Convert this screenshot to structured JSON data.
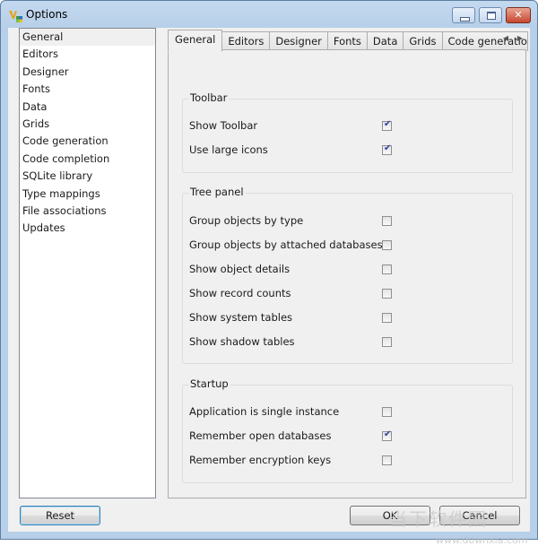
{
  "window": {
    "title": "Options",
    "controls": {
      "minimize": "minimize",
      "maximize": "maximize",
      "close": "✕"
    }
  },
  "sidebar": {
    "items": [
      {
        "label": "General",
        "selected": true
      },
      {
        "label": "Editors"
      },
      {
        "label": "Designer"
      },
      {
        "label": "Fonts"
      },
      {
        "label": "Data"
      },
      {
        "label": "Grids"
      },
      {
        "label": "Code generation"
      },
      {
        "label": "Code completion"
      },
      {
        "label": "SQLite library"
      },
      {
        "label": "Type mappings"
      },
      {
        "label": "File associations"
      },
      {
        "label": "Updates"
      }
    ]
  },
  "tabs": {
    "items": [
      {
        "label": "General",
        "active": true
      },
      {
        "label": "Editors"
      },
      {
        "label": "Designer"
      },
      {
        "label": "Fonts"
      },
      {
        "label": "Data"
      },
      {
        "label": "Grids"
      },
      {
        "label": "Code generatio"
      }
    ],
    "scroll_left": "◀",
    "scroll_right": "▶"
  },
  "groups": {
    "toolbar": {
      "title": "Toolbar",
      "options": [
        {
          "label": "Show Toolbar",
          "checked": true
        },
        {
          "label": "Use large icons",
          "checked": true
        }
      ]
    },
    "tree_panel": {
      "title": "Tree panel",
      "options": [
        {
          "label": "Group objects by type",
          "checked": false
        },
        {
          "label": "Group objects by attached databases",
          "checked": false
        },
        {
          "label": "Show object details",
          "checked": false
        },
        {
          "label": "Show record counts",
          "checked": false
        },
        {
          "label": "Show system tables",
          "checked": false
        },
        {
          "label": "Show shadow tables",
          "checked": false
        }
      ]
    },
    "startup": {
      "title": "Startup",
      "options": [
        {
          "label": "Application is single instance",
          "checked": false
        },
        {
          "label": "Remember open databases",
          "checked": true
        },
        {
          "label": "Remember encryption keys",
          "checked": false
        }
      ]
    }
  },
  "buttons": {
    "reset": "Reset",
    "ok": "OK",
    "cancel": "Cancel"
  },
  "checkmark": "✔",
  "watermark": {
    "text": "当下软件园",
    "url": "www.downxia.com"
  }
}
